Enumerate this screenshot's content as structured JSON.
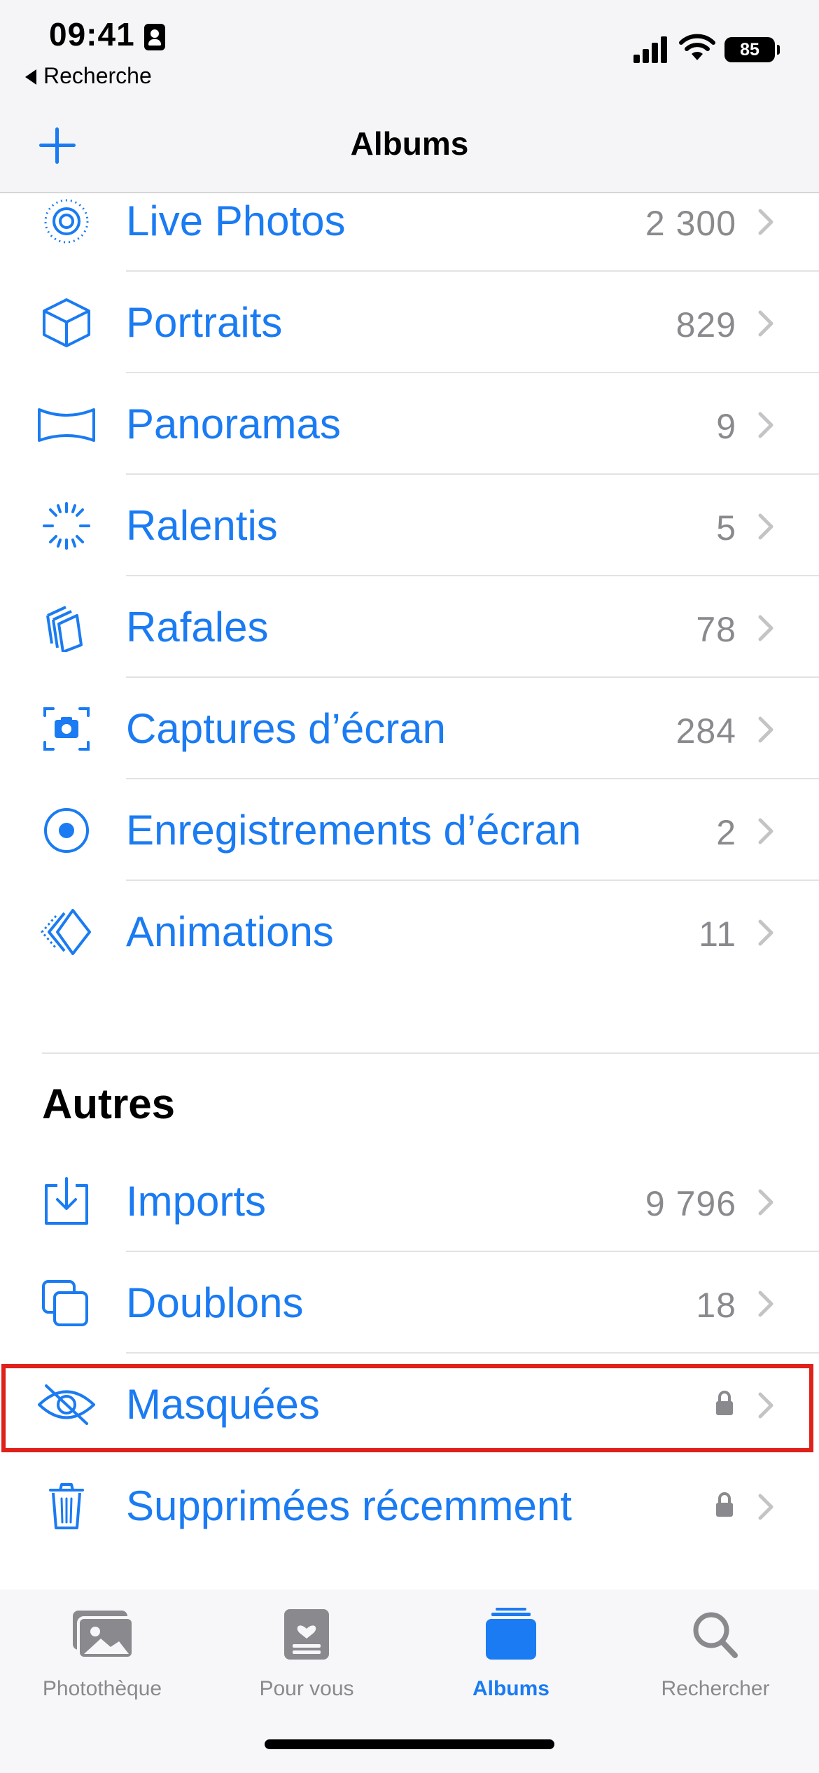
{
  "status_bar": {
    "time": "09:41",
    "back_label": "Recherche",
    "battery": "85"
  },
  "navbar": {
    "title": "Albums",
    "add_icon": "plus-icon"
  },
  "media_types": [
    {
      "label": "Live Photos",
      "count": "2 300",
      "icon": "live-photo-icon"
    },
    {
      "label": "Portraits",
      "count": "829",
      "icon": "cube-icon"
    },
    {
      "label": "Panoramas",
      "count": "9",
      "icon": "panorama-icon"
    },
    {
      "label": "Ralentis",
      "count": "5",
      "icon": "slowmo-icon"
    },
    {
      "label": "Rafales",
      "count": "78",
      "icon": "burst-icon"
    },
    {
      "label": "Captures d’écran",
      "count": "284",
      "icon": "screenshot-icon"
    },
    {
      "label": "Enregistrements d’écran",
      "count": "2",
      "icon": "screen-record-icon"
    },
    {
      "label": "Animations",
      "count": "11",
      "icon": "animation-icon"
    }
  ],
  "others": {
    "title": "Autres",
    "items": [
      {
        "label": "Imports",
        "count": "9 796",
        "icon": "import-icon"
      },
      {
        "label": "Doublons",
        "count": "18",
        "icon": "duplicate-icon"
      },
      {
        "label": "Masquées",
        "icon": "hidden-eye-icon",
        "locked": true
      },
      {
        "label": "Supprimées récemment",
        "icon": "trash-icon",
        "locked": true
      }
    ]
  },
  "tabs": [
    {
      "label": "Photothèque",
      "icon": "library-icon",
      "active": false
    },
    {
      "label": "Pour vous",
      "icon": "for-you-icon",
      "active": false
    },
    {
      "label": "Albums",
      "icon": "albums-icon",
      "active": true
    },
    {
      "label": "Rechercher",
      "icon": "search-icon",
      "active": false
    }
  ],
  "colors": {
    "accent": "#1a7bf2",
    "secondary_text": "#8a8a8e",
    "highlight": "#e0201a"
  }
}
